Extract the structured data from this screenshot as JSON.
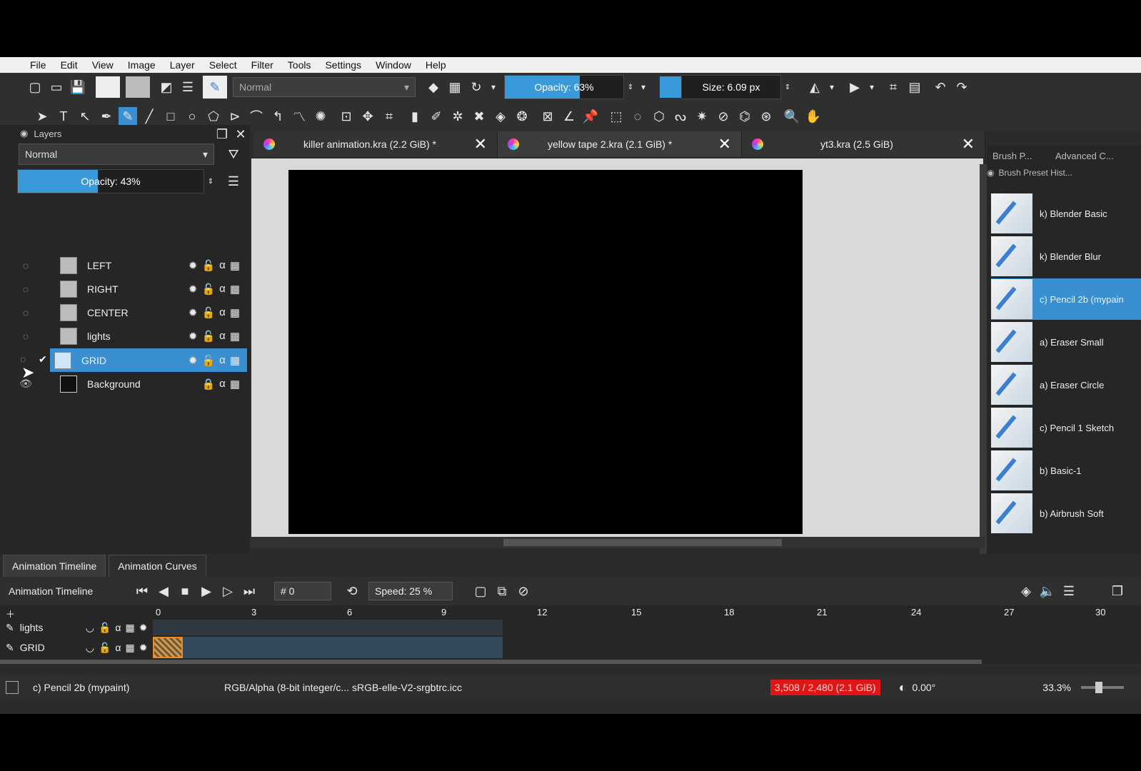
{
  "menu": [
    "File",
    "Edit",
    "View",
    "Image",
    "Layer",
    "Select",
    "Filter",
    "Tools",
    "Settings",
    "Window",
    "Help"
  ],
  "toolbar": {
    "blend_mode": "Normal",
    "opacity_label": "Opacity: 63%",
    "opacity_value": 63,
    "size_label": "Size: 6.09 px",
    "accent": "#3a9ad9"
  },
  "layers_panel": {
    "title": "Layers",
    "blend_mode": "Normal",
    "opacity_label": "Opacity: 43%",
    "opacity_value": 43,
    "layers": [
      {
        "name": "LEFT",
        "selected": false
      },
      {
        "name": "RIGHT",
        "selected": false
      },
      {
        "name": "CENTER",
        "selected": false
      },
      {
        "name": "lights",
        "selected": false
      },
      {
        "name": "GRID",
        "selected": true
      },
      {
        "name": "Background",
        "selected": false
      }
    ]
  },
  "doc_tabs": [
    {
      "title": "killer animation.kra (2.2 GiB) *"
    },
    {
      "title": "yellow tape 2.kra (2.1 GiB) *"
    },
    {
      "title": "yt3.kra (2.5 GiB)"
    }
  ],
  "brush_panel": {
    "tab1": "Brush P...",
    "tab2": "Advanced C...",
    "subtitle": "Brush Preset Hist...",
    "presets": [
      {
        "name": "k) Blender Basic",
        "selected": false
      },
      {
        "name": "k) Blender Blur",
        "selected": false
      },
      {
        "name": "c) Pencil 2b (mypain",
        "selected": true
      },
      {
        "name": "a) Eraser Small",
        "selected": false
      },
      {
        "name": "a) Eraser Circle",
        "selected": false
      },
      {
        "name": "c) Pencil 1 Sketch",
        "selected": false
      },
      {
        "name": "b) Basic-1",
        "selected": false
      },
      {
        "name": "b) Airbrush Soft",
        "selected": false
      }
    ]
  },
  "bottom": {
    "tab_timeline": "Animation Timeline",
    "tab_curves": "Animation Curves",
    "panel_title": "Animation Timeline",
    "frame_value": "# 0",
    "speed_label": "Speed: 25 %",
    "ruler": [
      "0",
      "3",
      "6",
      "9",
      "12",
      "15",
      "18",
      "21",
      "24",
      "27",
      "30"
    ],
    "rows": [
      {
        "name": "lights"
      },
      {
        "name": "GRID"
      }
    ]
  },
  "status": {
    "brush": "c) Pencil 2b (mypaint)",
    "color_profile": "RGB/Alpha (8-bit integer/c...  sRGB-elle-V2-srgbtrc.icc",
    "memory": "3,508 / 2,480 (2.1 GiB)",
    "rotation": "0.00°",
    "zoom": "33.3%"
  }
}
